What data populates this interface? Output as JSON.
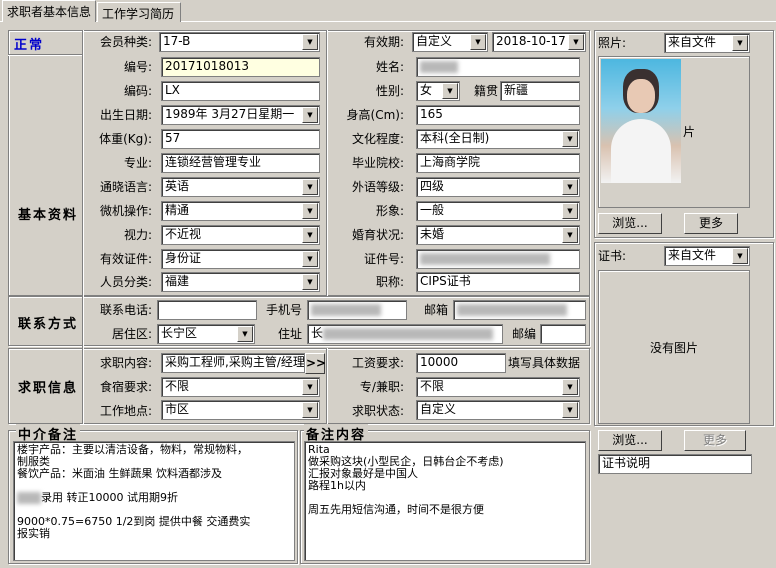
{
  "tabs": [
    {
      "label": "求职者基本信息"
    },
    {
      "label": "工作学习简历"
    }
  ],
  "status_text": "正常",
  "section_labels": {
    "basic": "基本资料",
    "contact": "联系方式",
    "job": "求职信息",
    "agent_memo": "中介备注",
    "memo": "备注内容"
  },
  "fields": {
    "member_type": {
      "label": "会员种类:",
      "value": "17-B"
    },
    "validity": {
      "label": "有效期:",
      "value": "自定义",
      "date": "2018-10-17"
    },
    "number": {
      "label": "编号:",
      "value": "20171018013"
    },
    "name": {
      "label": "姓名:",
      "value": ""
    },
    "code": {
      "label": "编码:",
      "value": "LX"
    },
    "gender": {
      "label": "性别:",
      "value": "女"
    },
    "native_place": {
      "label": "籍贯",
      "value": "新疆"
    },
    "birth_date": {
      "label": "出生日期:",
      "value": "1989年 3月27日星期一"
    },
    "height": {
      "label": "身高(Cm):",
      "value": "165"
    },
    "weight": {
      "label": "体重(Kg):",
      "value": "57"
    },
    "education": {
      "label": "文化程度:",
      "value": "本科(全日制)"
    },
    "major": {
      "label": "专业:",
      "value": "连锁经营管理专业"
    },
    "school": {
      "label": "毕业院校:",
      "value": "上海商学院"
    },
    "language": {
      "label": "通晓语言:",
      "value": "英语"
    },
    "foreign_level": {
      "label": "外语等级:",
      "value": "四级"
    },
    "computer": {
      "label": "微机操作:",
      "value": "精通"
    },
    "appearance": {
      "label": "形象:",
      "value": "一般"
    },
    "vision": {
      "label": "视力:",
      "value": "不近视"
    },
    "marital": {
      "label": "婚育状况:",
      "value": "未婚"
    },
    "id_type": {
      "label": "有效证件:",
      "value": "身份证"
    },
    "id_number": {
      "label": "证件号:",
      "value": ""
    },
    "category": {
      "label": "人员分类:",
      "value": "福建"
    },
    "title": {
      "label": "职称:",
      "value": "CIPS证书"
    },
    "phone": {
      "label": "联系电话:",
      "value": ""
    },
    "mobile": {
      "label": "手机号",
      "value": ""
    },
    "email": {
      "label": "邮箱",
      "value": ""
    },
    "district": {
      "label": "居住区:",
      "value": "长宁区"
    },
    "address": {
      "label": "住址",
      "value": "长"
    },
    "postcode": {
      "label": "邮编",
      "value": ""
    },
    "job_content": {
      "label": "求职内容:",
      "value": "采购工程师,采购主管/经理"
    },
    "salary": {
      "label": "工资要求:",
      "value": "10000",
      "hint": "填写具体数据"
    },
    "accommodation": {
      "label": "食宿要求:",
      "value": "不限"
    },
    "fulltime": {
      "label": "专/兼职:",
      "value": "不限"
    },
    "work_location": {
      "label": "工作地点:",
      "value": "市区"
    },
    "job_status": {
      "label": "求职状态:",
      "value": "自定义"
    }
  },
  "more_button": ">>",
  "photo": {
    "label": "照片:",
    "source": "来自文件",
    "placeholder_fragment": "片",
    "browse": "浏览...",
    "more": "更多"
  },
  "certificate": {
    "label": "证书:",
    "source": "来自文件",
    "no_image": "没有图片",
    "browse": "浏览...",
    "more": "更多",
    "description": "证书说明"
  },
  "agent_memo_lines": [
    "楼宇产品：主要以清洁设备，物料，常规物料，",
    "制服类",
    "餐饮产品：米面油 生鲜蔬果 饮料酒都涉及",
    "",
    "录用   转正10000  试用期9折",
    "",
    "9000*0.75=6750  1/2到岗  提供中餐  交通费实",
    "报实销"
  ],
  "memo_lines": [
    "Rita",
    "做采购这块(小型民企，日韩台企不考虑)",
    "汇报对象最好是中国人",
    "路程1h以内",
    "",
    "周五先用短信沟通，时间不是很方便"
  ],
  "colors": {
    "status": "#0000cc",
    "window": "#d4d0c8",
    "highlight_input": "#ffffe1"
  }
}
